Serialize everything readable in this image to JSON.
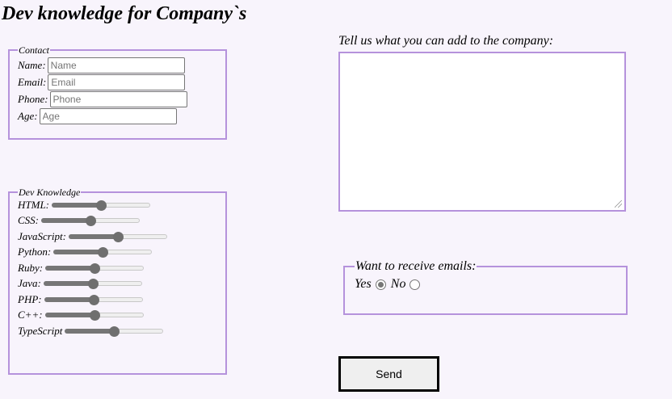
{
  "page_title": "Dev knowledge for Company`s",
  "contact": {
    "legend": "Contact",
    "fields": [
      {
        "label": "Name:",
        "placeholder": "Name",
        "value": ""
      },
      {
        "label": "Email:",
        "placeholder": "Email",
        "value": ""
      },
      {
        "label": "Phone:",
        "placeholder": "Phone",
        "value": ""
      },
      {
        "label": "Age:",
        "placeholder": "Age",
        "value": ""
      }
    ]
  },
  "dev_knowledge": {
    "legend": "Dev Knowledge",
    "skills": [
      {
        "label": "HTML:",
        "level": 0.5
      },
      {
        "label": "CSS:",
        "level": 0.5
      },
      {
        "label": "JavaScript:",
        "level": 0.5
      },
      {
        "label": "Python:",
        "level": 0.5
      },
      {
        "label": "Ruby:",
        "level": 0.5
      },
      {
        "label": "Java:",
        "level": 0.5
      },
      {
        "label": "PHP:",
        "level": 0.5
      },
      {
        "label": "C++:",
        "level": 0.5
      },
      {
        "label": "TypeScript",
        "level": 0.5
      }
    ]
  },
  "company_text": {
    "label": "Tell us what you can add to the company:",
    "value": ""
  },
  "emails": {
    "legend": "Want to receive emails:",
    "options": [
      {
        "label": "Yes",
        "checked": true
      },
      {
        "label": "No",
        "checked": false
      }
    ]
  },
  "send_label": "Send",
  "colors": {
    "background": "#f8f4fc",
    "border_accent": "#b592dc",
    "slider": "#767676"
  }
}
